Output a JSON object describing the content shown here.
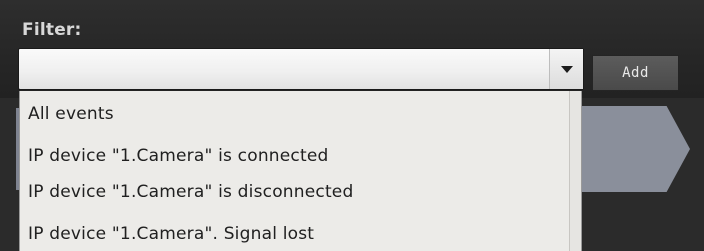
{
  "filter": {
    "label": "Filter:",
    "input_value": "",
    "add_label": "Add",
    "options": [
      "All events",
      "IP device \"1.Camera\" is connected",
      "IP device \"1.Camera\" is disconnected",
      "IP device \"1.Camera\". Signal lost"
    ]
  },
  "icons": {
    "dropdown_toggle": "chevron-down-icon"
  },
  "colors": {
    "background": "#2b2b2b",
    "dropdown_bg": "#ecebe8",
    "arrow_block": "#8a8f9b",
    "add_button": "#4f4f4f"
  }
}
